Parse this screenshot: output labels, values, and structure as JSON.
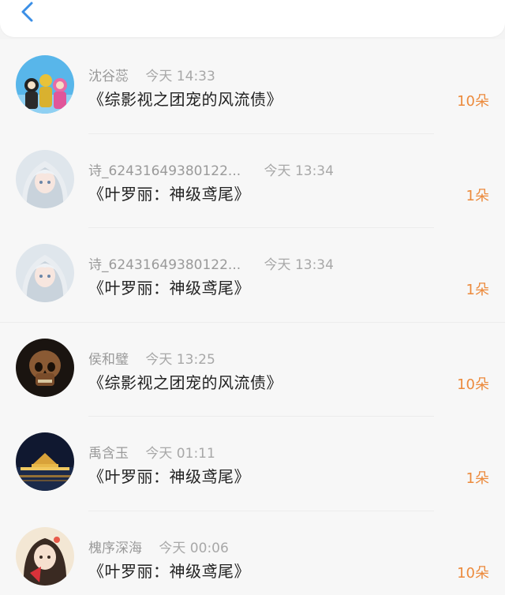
{
  "header": {
    "back_icon": "chevron-left-icon",
    "accent": "#3b8fe6"
  },
  "colors": {
    "amount": "#ec8a3c"
  },
  "items": [
    {
      "name": "沈谷蕊",
      "time": "今天 14:33",
      "book": "《综影视之团宠的风流债》",
      "amount": "10朵",
      "avatar": "cartoon-avatar"
    },
    {
      "name": "诗_62431649380122...",
      "time": "今天 13:34",
      "book": "《叶罗丽：神级鸢尾》",
      "amount": "1朵",
      "avatar": "anime-girl-avatar"
    },
    {
      "name": "诗_62431649380122...",
      "time": "今天 13:34",
      "book": "《叶罗丽：神级鸢尾》",
      "amount": "1朵",
      "avatar": "anime-girl-avatar"
    },
    {
      "name": "侯和璧",
      "time": "今天 13:25",
      "book": "《综影视之团宠的风流债》",
      "amount": "10朵",
      "avatar": "skull-avatar"
    },
    {
      "name": "禹含玉",
      "time": "今天 01:11",
      "book": "《叶罗丽：神级鸢尾》",
      "amount": "1朵",
      "avatar": "night-city-avatar"
    },
    {
      "name": "槐序深海",
      "time": "今天 00:06",
      "book": "《叶罗丽：神级鸢尾》",
      "amount": "10朵",
      "avatar": "anime-fan-girl-avatar"
    }
  ]
}
